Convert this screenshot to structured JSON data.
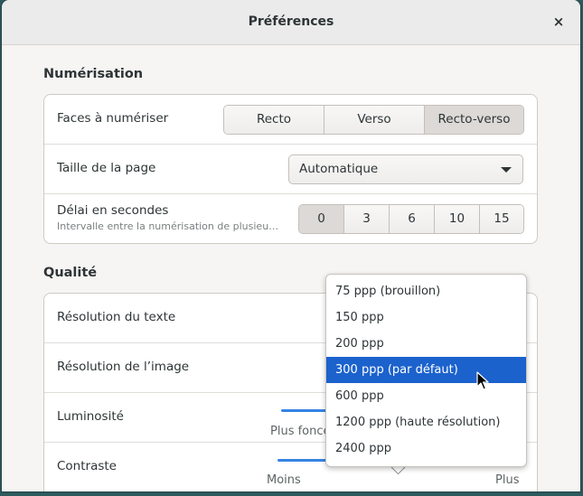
{
  "window": {
    "title": "Préférences",
    "close_label": "×"
  },
  "scan_section": {
    "title": "Numérisation",
    "sides": {
      "label": "Faces à numériser",
      "options": [
        "Recto",
        "Verso",
        "Recto-verso"
      ],
      "selected": "Recto-verso"
    },
    "page_size": {
      "label": "Taille de la page",
      "value": "Automatique"
    },
    "delay": {
      "label": "Délai en secondes",
      "sublabel": "Intervalle entre la numérisation de plusieu…",
      "options": [
        "0",
        "3",
        "6",
        "10",
        "15"
      ],
      "selected": "0"
    }
  },
  "quality_section": {
    "title": "Qualité",
    "text_resolution": {
      "label": "Résolution du texte"
    },
    "image_resolution": {
      "label": "Résolution de l’image"
    },
    "brightness": {
      "label": "Luminosité",
      "min_label": "Plus foncé"
    },
    "contrast": {
      "label": "Contraste",
      "min_label": "Moins",
      "max_label": "Plus"
    }
  },
  "resolution_menu": {
    "items": [
      "75 ppp (brouillon)",
      "150 ppp",
      "200 ppp",
      "300 ppp (par défaut)",
      "600 ppp",
      "1200 ppp (haute résolution)",
      "2400 ppp"
    ],
    "selected_index": 3
  },
  "colors": {
    "accent": "#3584e4",
    "selection": "#1c62cd"
  }
}
